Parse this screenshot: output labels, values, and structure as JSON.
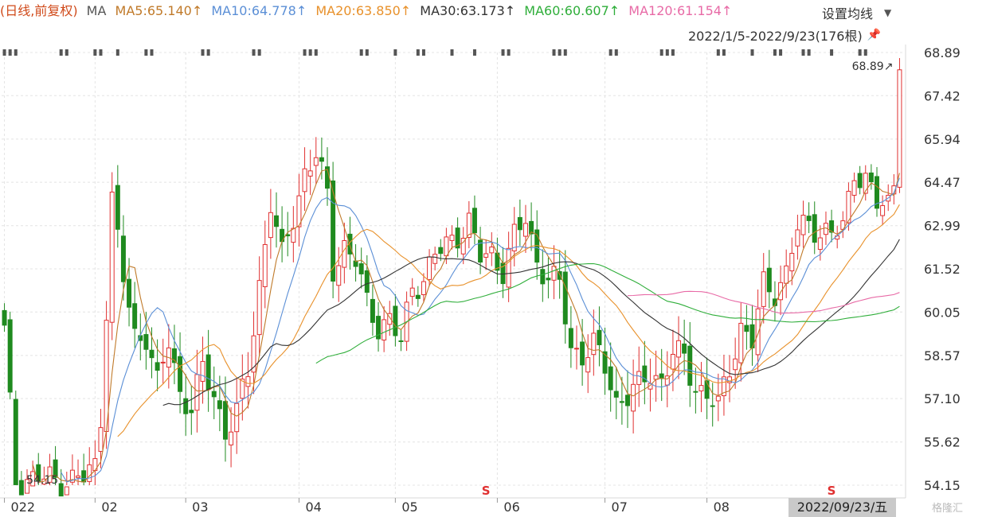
{
  "legend": {
    "mode": "(日线,前复权)",
    "ma_label": "MA",
    "items": [
      {
        "label": "MA5:65.140↑",
        "color": "#c07a2a"
      },
      {
        "label": "MA10:64.778↑",
        "color": "#5b8fd6"
      },
      {
        "label": "MA20:63.850↑",
        "color": "#e8912b"
      },
      {
        "label": "MA30:63.173↑",
        "color": "#333333"
      },
      {
        "label": "MA60:60.607↑",
        "color": "#2fae3a"
      },
      {
        "label": "MA120:61.154↑",
        "color": "#e86aa6"
      }
    ],
    "mode_color": "#d04a1a",
    "ma_color": "#555555"
  },
  "controls": {
    "settings_label": "设置均线",
    "range_label": "2022/1/5-2022/9/23(176根)"
  },
  "footer": {
    "current_date": "2022/09/23/五",
    "watermark": "格隆汇"
  },
  "chart_data": {
    "type": "candlestick",
    "ylim": [
      54.15,
      68.89
    ],
    "y_ticks": [
      "68.89",
      "67.42",
      "65.94",
      "64.47",
      "62.99",
      "61.52",
      "60.05",
      "58.57",
      "57.10",
      "55.62",
      "54.15"
    ],
    "x_ticks": [
      {
        "label": "022",
        "index": 0
      },
      {
        "label": "02",
        "index": 16
      },
      {
        "label": "03",
        "index": 32
      },
      {
        "label": "04",
        "index": 52
      },
      {
        "label": "05",
        "index": 69
      },
      {
        "label": "06",
        "index": 87
      },
      {
        "label": "07",
        "index": 106
      },
      {
        "label": "08",
        "index": 124
      }
    ],
    "annotations": [
      {
        "text": "68.89↗",
        "index": 158,
        "value": 68.89
      },
      {
        "text": "54.15",
        "index": 5,
        "value": 54.15
      }
    ],
    "event_markers": [
      {
        "text": "S",
        "index": 85
      },
      {
        "text": "S",
        "index": 146
      }
    ],
    "colors": {
      "up": "#e03030",
      "down": "#1f8a1f",
      "grid": "#e4e4e4"
    },
    "keypoints": [
      [
        0,
        59.4
      ],
      [
        2,
        54.3
      ],
      [
        6,
        54.4
      ],
      [
        10,
        54.3
      ],
      [
        14,
        54.4
      ],
      [
        16,
        54.8
      ],
      [
        17,
        56.5
      ],
      [
        19,
        63.9
      ],
      [
        21,
        61.2
      ],
      [
        23,
        59.2
      ],
      [
        25,
        59.3
      ],
      [
        27,
        57.6
      ],
      [
        29,
        59.0
      ],
      [
        31,
        57.3
      ],
      [
        33,
        56.8
      ],
      [
        35,
        58.1
      ],
      [
        37,
        57.2
      ],
      [
        39,
        56.0
      ],
      [
        41,
        56.6
      ],
      [
        43,
        58.0
      ],
      [
        45,
        61.0
      ],
      [
        47,
        63.8
      ],
      [
        49,
        61.9
      ],
      [
        51,
        63.3
      ],
      [
        53,
        64.8
      ],
      [
        55,
        65.4
      ],
      [
        57,
        64.0
      ],
      [
        58,
        61.5
      ],
      [
        60,
        62.3
      ],
      [
        62,
        61.8
      ],
      [
        64,
        60.3
      ],
      [
        66,
        59.6
      ],
      [
        68,
        59.8
      ],
      [
        70,
        59.0
      ],
      [
        72,
        60.9
      ],
      [
        74,
        61.2
      ],
      [
        76,
        62.0
      ],
      [
        78,
        62.3
      ],
      [
        80,
        62.7
      ],
      [
        82,
        63.1
      ],
      [
        84,
        61.9
      ],
      [
        86,
        62.0
      ],
      [
        88,
        61.5
      ],
      [
        90,
        62.6
      ],
      [
        92,
        63.2
      ],
      [
        94,
        61.8
      ],
      [
        96,
        61.2
      ],
      [
        98,
        61.0
      ],
      [
        100,
        58.8
      ],
      [
        102,
        58.6
      ],
      [
        104,
        58.9
      ],
      [
        106,
        58.2
      ],
      [
        108,
        57.0
      ],
      [
        110,
        57.2
      ],
      [
        112,
        57.5
      ],
      [
        114,
        58.0
      ],
      [
        116,
        57.7
      ],
      [
        118,
        58.6
      ],
      [
        120,
        58.5
      ],
      [
        122,
        57.5
      ],
      [
        124,
        57.2
      ],
      [
        126,
        56.8
      ],
      [
        128,
        58.2
      ],
      [
        130,
        59.5
      ],
      [
        132,
        59.0
      ],
      [
        134,
        61.0
      ],
      [
        136,
        60.8
      ],
      [
        138,
        61.3
      ],
      [
        140,
        62.9
      ],
      [
        142,
        63.1
      ],
      [
        144,
        62.8
      ],
      [
        146,
        62.6
      ],
      [
        148,
        63.0
      ],
      [
        150,
        64.9
      ],
      [
        152,
        64.5
      ],
      [
        154,
        63.7
      ],
      [
        156,
        63.8
      ],
      [
        157,
        64.5
      ],
      [
        158,
        68.3
      ],
      [
        175,
        68.3
      ]
    ],
    "ma_series": [
      {
        "name": "MA5",
        "color": "#c07a2a",
        "start": 5,
        "window": 5
      },
      {
        "name": "MA10",
        "color": "#5b8fd6",
        "start": 10,
        "window": 10
      },
      {
        "name": "MA20",
        "color": "#e8912b",
        "start": 20,
        "window": 20
      },
      {
        "name": "MA30",
        "color": "#333333",
        "start": 28,
        "window": 30
      },
      {
        "name": "MA60",
        "color": "#2fae3a",
        "start": 55,
        "window": 60
      },
      {
        "name": "MA120",
        "color": "#e86aa6",
        "start": 110,
        "window": 80
      }
    ],
    "visible_bars": 159
  }
}
